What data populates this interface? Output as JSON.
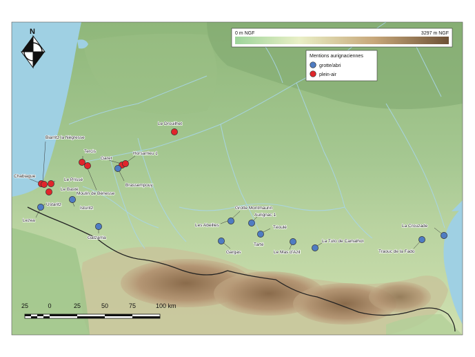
{
  "elevation_legend": {
    "min_label": "0 m NGF",
    "max_label": "3297 m NGF"
  },
  "site_legend": {
    "title": "Mentions aurignaciennes",
    "categories": [
      {
        "label": "grotte/abri",
        "color": "#4f7cc2"
      },
      {
        "label": "plein-air",
        "color": "#e0262b"
      }
    ]
  },
  "north_arrow": {
    "label": "N"
  },
  "scale_bar": {
    "ticks": [
      "25",
      "0",
      "25",
      "50",
      "75",
      "100 km"
    ]
  },
  "sites": [
    {
      "name": "Le Drouilhet",
      "type": "plein-air"
    },
    {
      "name": "Biarritz la Négresse",
      "type": "plein-air"
    },
    {
      "name": "Tercis",
      "type": "plein-air"
    },
    {
      "name": "Garet",
      "type": "plein-air"
    },
    {
      "name": "Horsarrieu 1",
      "type": "plein-air"
    },
    {
      "name": "Brassempouy",
      "type": "grotte/abri"
    },
    {
      "name": "Chabiague",
      "type": "plein-air"
    },
    {
      "name": "Le Prissé",
      "type": "plein-air"
    },
    {
      "name": "Le Basté",
      "type": "plein-air"
    },
    {
      "name": "Moulin de Bénesse",
      "type": "plein-air"
    },
    {
      "name": "Ustaritz",
      "type": "grotte/abri"
    },
    {
      "name": "Isturitz",
      "type": "grotte/abri"
    },
    {
      "name": "Lezea",
      "type": "grotte/abri"
    },
    {
      "name": "Gatzarria",
      "type": "grotte/abri"
    },
    {
      "name": "Grotte Montmaurin",
      "type": "grotte/abri"
    },
    {
      "name": "Les Abeilles",
      "type": "grotte/abri"
    },
    {
      "name": "Aurignac 1",
      "type": "grotte/abri"
    },
    {
      "name": "Téoulé",
      "type": "grotte/abri"
    },
    {
      "name": "Gargas",
      "type": "grotte/abri"
    },
    {
      "name": "Tarté",
      "type": "grotte/abri"
    },
    {
      "name": "Le Mas d'Azil",
      "type": "grotte/abri"
    },
    {
      "name": "La Tuto de Camalhot",
      "type": "grotte/abri"
    },
    {
      "name": "La Crouzade",
      "type": "grotte/abri"
    },
    {
      "name": "Traouc de la Fado",
      "type": "grotte/abri"
    }
  ]
}
